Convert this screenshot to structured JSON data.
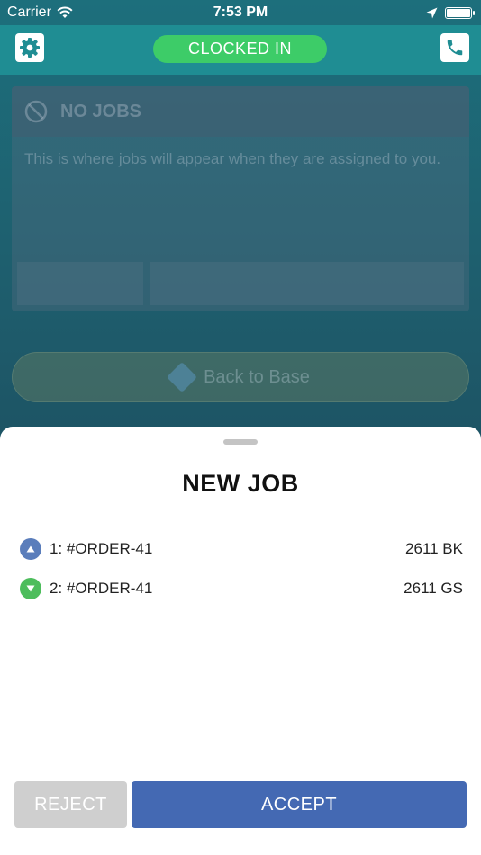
{
  "status_bar": {
    "carrier": "Carrier",
    "time": "7:53 PM"
  },
  "header": {
    "clock_status": "CLOCKED IN"
  },
  "background": {
    "no_jobs_title": "NO JOBS",
    "no_jobs_message": "This is where jobs will appear when they are assigned to you.",
    "back_to_base_label": "Back to Base"
  },
  "sheet": {
    "title": "NEW JOB",
    "jobs": [
      {
        "label": "1: #ORDER-41",
        "postal": "2611 BK",
        "type": "pickup"
      },
      {
        "label": "2: #ORDER-41",
        "postal": "2611 GS",
        "type": "dropoff"
      }
    ],
    "reject_label": "REJECT",
    "accept_label": "ACCEPT"
  },
  "colors": {
    "nav_bar": "#1f8d93",
    "clocked_in": "#3dcc68",
    "accept": "#4469b3",
    "reject": "#cfcfcf",
    "pickup_dot": "#5a7dbb",
    "dropoff_dot": "#4dbd5c"
  }
}
